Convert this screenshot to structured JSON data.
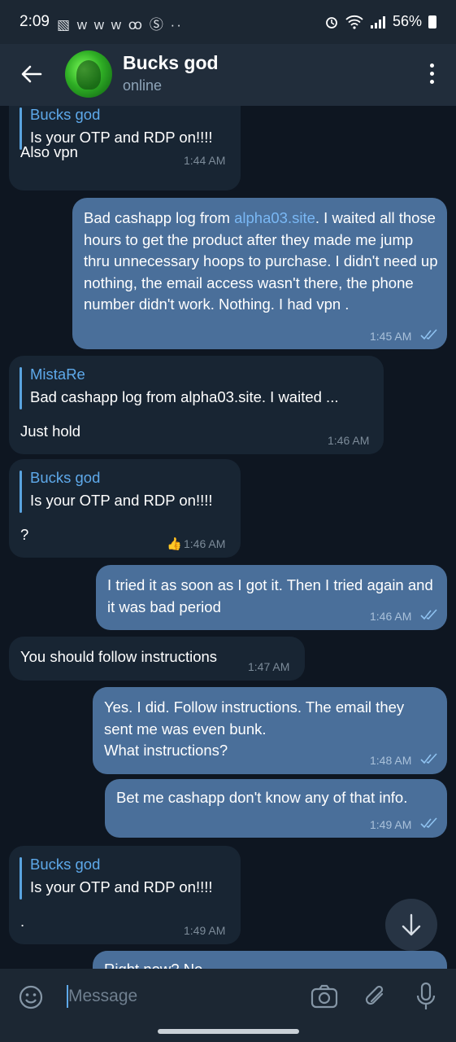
{
  "status_bar": {
    "time": "2:09",
    "left_icons": "▧ w w w ꝏ Ⓢ ··",
    "battery": "56%"
  },
  "header": {
    "name": "Bucks god",
    "status": "online"
  },
  "messages": {
    "m1": {
      "reply_name": "Bucks god",
      "reply_text": "Is your OTP and RDP on!!!!",
      "text": "Also vpn",
      "time": "1:44 AM"
    },
    "m2": {
      "text_before": "Bad cashapp log from ",
      "link": "alpha03.site",
      "text_after": ". I waited all those hours to get the product after they made me jump thru unnecessary hoops to purchase. I didn't need up nothing, the email access wasn't there, the phone number didn't work. Nothing. I had vpn .",
      "time": "1:45 AM"
    },
    "m3": {
      "reply_name": "MistaRe",
      "reply_text": "Bad cashapp log from alpha03.site. I waited ...",
      "text": "Just hold",
      "time": "1:46 AM"
    },
    "m4": {
      "reply_name": "Bucks god",
      "reply_text": "Is your OTP and RDP on!!!!",
      "text": "?",
      "reaction": "👍",
      "time": "1:46 AM"
    },
    "m5": {
      "text": "I tried it as soon as I got it. Then I tried again and it was bad period",
      "time": "1:46 AM"
    },
    "m6": {
      "text": "You should follow instructions",
      "time": "1:47 AM"
    },
    "m7": {
      "line1": "Yes. I did. Follow instructions. The email they",
      "line2": "sent me was even bunk.",
      "line3": "What instructions?",
      "time": "1:48 AM"
    },
    "m8": {
      "text": "Bet me cashapp don't know any of that info.",
      "time": "1:49 AM"
    },
    "m9": {
      "reply_name": "Bucks god",
      "reply_text": "Is your OTP and RDP on!!!!",
      "text": ".",
      "time": "1:49 AM"
    },
    "m10": {
      "text": "Right now? No"
    }
  },
  "input": {
    "placeholder": "Message"
  },
  "colors": {
    "background": "#0e1621",
    "incoming": "#182533",
    "outgoing": "#4a6f9a",
    "accent": "#5ea9ea"
  },
  "icons": [
    "back-arrow-icon",
    "more-vertical-icon",
    "emoji-icon",
    "camera-icon",
    "attach-icon",
    "mic-icon",
    "scroll-down-icon",
    "double-check-icon"
  ]
}
